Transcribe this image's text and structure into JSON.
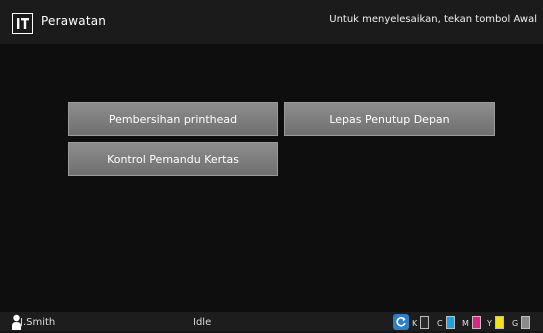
{
  "header": {
    "title": "Perawatan",
    "hint": "Untuk menyelesaikan, tekan tombol Awal",
    "icon": "maintenance-icon"
  },
  "buttons": {
    "printhead_clean": "Pembersihan printhead",
    "release_front_cover": "Lepas Penutup Depan",
    "paper_guide_control": "Kontrol Pemandu Kertas"
  },
  "statusbar": {
    "user": "J.Smith",
    "status": "Idle",
    "inks": [
      {
        "label": "K",
        "color": "#2b2b2b"
      },
      {
        "label": "C",
        "color": "#1fa3e0"
      },
      {
        "label": "M",
        "color": "#e0218a"
      },
      {
        "label": "Y",
        "color": "#f2e21a"
      },
      {
        "label": "G",
        "color": "#8a8a8a"
      }
    ]
  }
}
